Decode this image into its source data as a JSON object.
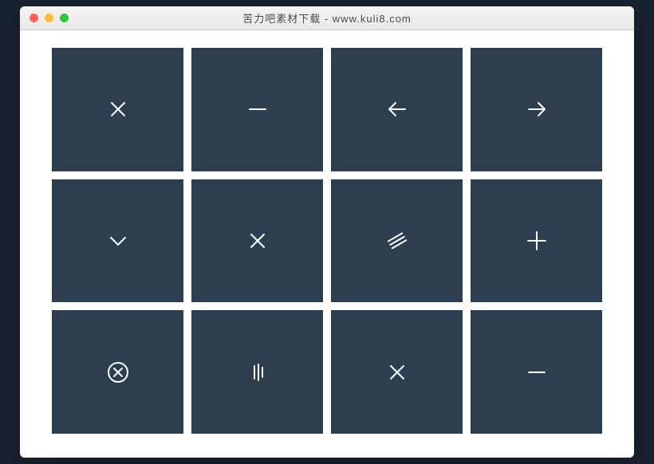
{
  "window": {
    "title": "苦力吧素材下载 - www.kuli8.com"
  },
  "colors": {
    "tile_bg": "#2c3e50",
    "icon_stroke": "#ffffff",
    "page_bg": "#ffffff",
    "body_bg": "#1a2332"
  },
  "tiles": [
    {
      "name": "close-icon"
    },
    {
      "name": "minus-icon"
    },
    {
      "name": "arrow-left-icon"
    },
    {
      "name": "arrow-right-icon"
    },
    {
      "name": "chevron-down-icon"
    },
    {
      "name": "x-icon"
    },
    {
      "name": "diagonal-lines-icon"
    },
    {
      "name": "plus-icon"
    },
    {
      "name": "close-circle-icon"
    },
    {
      "name": "vertical-bars-icon"
    },
    {
      "name": "x-icon-2"
    },
    {
      "name": "minus-icon-2"
    }
  ]
}
